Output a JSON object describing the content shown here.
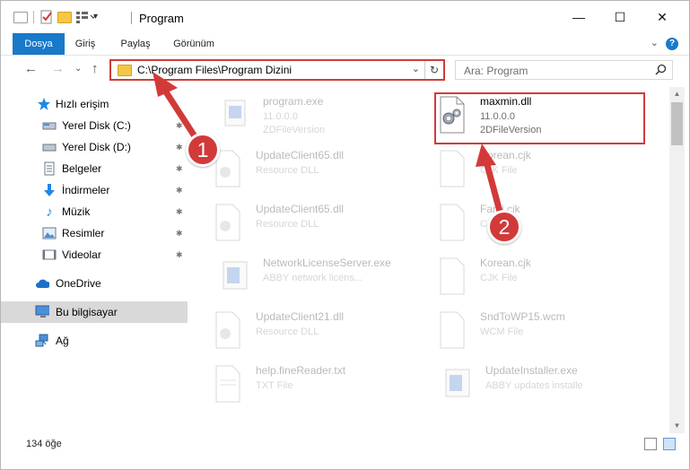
{
  "window": {
    "title": "Program",
    "controls": {
      "minimize": "—",
      "maximize": "☐",
      "close": "✕"
    }
  },
  "ribbon": {
    "tabs": [
      {
        "label": "Dosya",
        "active": true
      },
      {
        "label": "Giriş"
      },
      {
        "label": "Paylaş"
      },
      {
        "label": "Görünüm"
      }
    ],
    "help": "?",
    "collapse": "⌄"
  },
  "navigation": {
    "back": "←",
    "forward": "→",
    "recent": "⌄",
    "up": "↑",
    "address": "C:\\Program Files\\Program Dizini",
    "address_dropdown": "⌄",
    "refresh": "↻",
    "search_placeholder": "Ara: Program",
    "search_icon": "search-icon"
  },
  "sidebar": {
    "items": [
      {
        "label": "Hızlı erişim",
        "icon": "star-icon"
      },
      {
        "label": "Yerel Disk (C:)",
        "icon": "drive-icon",
        "pinned": true
      },
      {
        "label": "Yerel Disk (D:)",
        "icon": "drive-icon",
        "pinned": true
      },
      {
        "label": "Belgeler",
        "icon": "documents-icon",
        "pinned": true
      },
      {
        "label": "İndirmeler",
        "icon": "download-icon",
        "pinned": true
      },
      {
        "label": "Müzik",
        "icon": "music-icon",
        "pinned": true
      },
      {
        "label": "Resimler",
        "icon": "pictures-icon",
        "pinned": true
      },
      {
        "label": "Videolar",
        "icon": "videos-icon",
        "pinned": true
      },
      {
        "label": "OneDrive",
        "icon": "cloud-icon"
      },
      {
        "label": "Bu bilgisayar",
        "icon": "computer-icon",
        "selected": true
      },
      {
        "label": "Ağ",
        "icon": "network-icon"
      }
    ],
    "pin_glyph": "📌"
  },
  "files": [
    {
      "name": "program.exe",
      "line1": "11.0.0.0",
      "line2": "ZDFileVersion",
      "icon": "exe-icon",
      "faded": true
    },
    {
      "name": "maxmin.dll",
      "line1": "11.0.0.0",
      "line2": "2DFileVersion",
      "icon": "dll-gear-icon",
      "faded": false,
      "highlighted": true
    },
    {
      "name": "UpdateClient65.dll",
      "line1": "Resource DLL",
      "line2": "",
      "icon": "dll-icon",
      "faded": true
    },
    {
      "name": "Korean.cjk",
      "line1": "CJK File",
      "line2": "",
      "icon": "file-icon",
      "faded": true
    },
    {
      "name": "UpdateClient65.dll",
      "line1": "Resource DLL",
      "line2": "",
      "icon": "dll-icon",
      "faded": true
    },
    {
      "name": "Farsi.cjk",
      "line1": "CJK File",
      "line2": "",
      "icon": "file-icon",
      "faded": true
    },
    {
      "name": "NetworkLicenseServer.exe",
      "line1": "ABBY network licens...",
      "line2": "",
      "icon": "exe-blue-icon",
      "faded": true
    },
    {
      "name": "Korean.cjk",
      "line1": "CJK File",
      "line2": "",
      "icon": "file-icon",
      "faded": true
    },
    {
      "name": "UpdateClient21.dll",
      "line1": "Resource DLL",
      "line2": "",
      "icon": "dll-icon",
      "faded": true
    },
    {
      "name": "SndToWP15.wcm",
      "line1": "WCM File",
      "line2": "",
      "icon": "file-icon",
      "faded": true
    },
    {
      "name": "help.fineReader.txt",
      "line1": "TXT File",
      "line2": "",
      "icon": "txt-icon",
      "faded": true
    },
    {
      "name": "UpdateInstaller.exe",
      "line1": "ABBY updates installe",
      "line2": "",
      "icon": "exe-blue-icon",
      "faded": true
    }
  ],
  "status": {
    "count": "134 öğe"
  },
  "annotations": [
    {
      "number": "1",
      "color": "#d23a3a"
    },
    {
      "number": "2",
      "color": "#d23a3a"
    }
  ],
  "colors": {
    "accent": "#1979ca",
    "annotation": "#d23a3a",
    "folder": "#f5c748"
  }
}
